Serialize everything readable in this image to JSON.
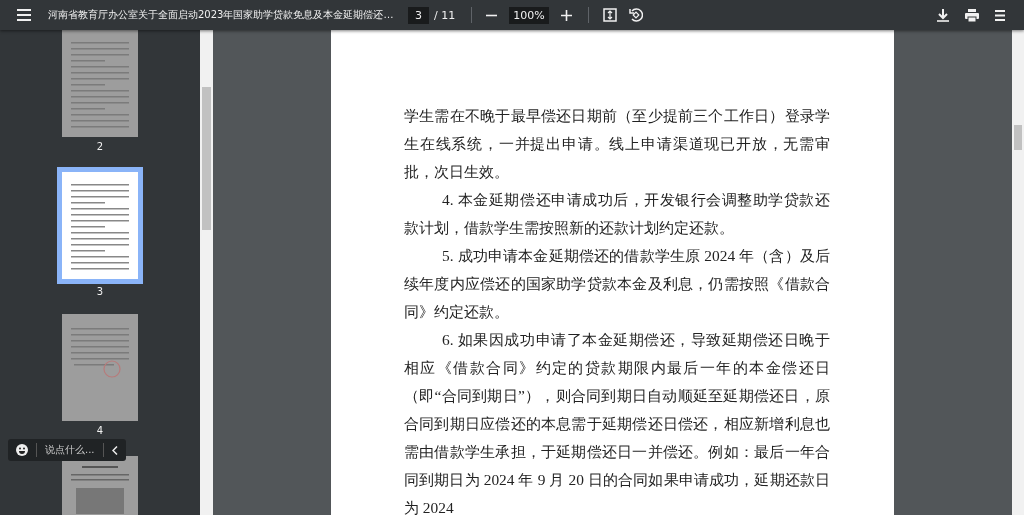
{
  "toolbar": {
    "title": "河南省教育厅办公室关于全面启动2023年国家助学贷款免息及本金延期偿还…",
    "page_current": "3",
    "page_total": "/ 11",
    "zoom": "100%"
  },
  "thumbnails": [
    {
      "label": "2",
      "kind": "text",
      "selected": false
    },
    {
      "label": "3",
      "kind": "text",
      "selected": true
    },
    {
      "label": "4",
      "kind": "stamped",
      "selected": false
    },
    {
      "kind": "figure",
      "selected": false
    }
  ],
  "chat_widget": {
    "placeholder": "说点什么..."
  },
  "document": {
    "paragraphs": [
      {
        "continued": true,
        "text": "学生需在不晚于最早偿还日期前（至少提前三个工作日）登录学生在线系统，一并提出申请。线上申请渠道现已开放，无需审批，次日生效。"
      },
      {
        "continued": false,
        "text": "4. 本金延期偿还申请成功后，开发银行会调整助学贷款还款计划，借款学生需按照新的还款计划约定还款。"
      },
      {
        "continued": false,
        "text": "5. 成功申请本金延期偿还的借款学生原 2024 年（含）及后续年度内应偿还的国家助学贷款本金及利息，仍需按照《借款合同》约定还款。"
      },
      {
        "continued": false,
        "text": "6. 如果因成功申请了本金延期偿还，导致延期偿还日晚于相应《借款合同》约定的贷款期限内最后一年的本金偿还日（即“合同到期日”），则合同到期日自动顺延至延期偿还日，原合同到期日应偿还的本息需于延期偿还日偿还，相应新增利息也需由借款学生承担，于延期偿还日一并偿还。例如：最后一年合同到期日为 2024 年 9 月 20 日的合同如果申请成功，延期还款日为 2024"
      }
    ]
  }
}
